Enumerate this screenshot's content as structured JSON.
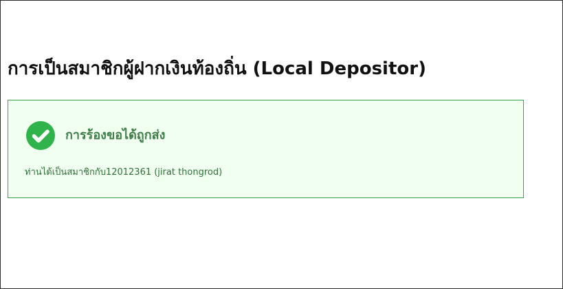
{
  "page": {
    "title": "การเป็นสมาชิกผู้ฝากเงินท้องถิ่น (Local Depositor)"
  },
  "success": {
    "heading": "การร้องขอได้ถูกส่ง",
    "message": "ท่านได้เป็นสมาชิกกับ12012361 (jirat thongrod)",
    "icon": "check-circle-icon",
    "colors": {
      "accent": "#2fb34a",
      "border": "#31a64b",
      "background": "#f1fff0",
      "text": "#3f7e49"
    }
  }
}
